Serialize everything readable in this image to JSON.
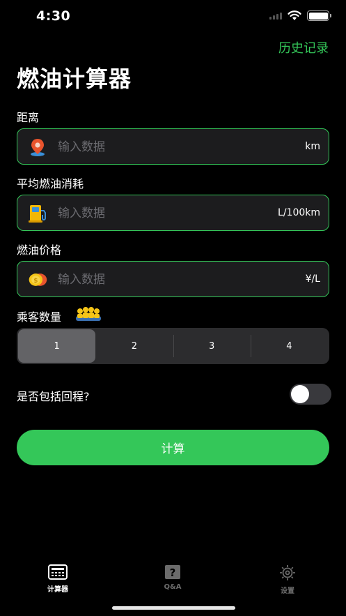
{
  "status_bar": {
    "time": "4:30"
  },
  "header": {
    "history_label": "历史记录",
    "title": "燃油计算器"
  },
  "fields": [
    {
      "label": "距离",
      "placeholder": "输入数据",
      "unit": "km",
      "icon": "location-pin-icon"
    },
    {
      "label": "平均燃油消耗",
      "placeholder": "输入数据",
      "unit": "L/100km",
      "icon": "fuel-pump-icon"
    },
    {
      "label": "燃油价格",
      "placeholder": "输入数据",
      "unit": "¥/L",
      "icon": "coins-icon"
    }
  ],
  "passengers": {
    "label": "乘客数量",
    "icon": "people-group-icon",
    "options": [
      "1",
      "2",
      "3",
      "4"
    ],
    "selected": "1"
  },
  "round_trip": {
    "label": "是否包括回程?",
    "enabled": false
  },
  "calculate_button": {
    "label": "计算"
  },
  "colors": {
    "accent": "#34c759",
    "field_bg": "#1c1c1e",
    "segment_bg": "#2c2c2e",
    "segment_active": "#636366"
  },
  "tabbar": [
    {
      "label": "计算器",
      "icon": "calculator-icon",
      "active": true
    },
    {
      "label": "Q&A",
      "icon": "question-icon",
      "active": false
    },
    {
      "label": "设置",
      "icon": "gear-icon",
      "active": false
    }
  ]
}
